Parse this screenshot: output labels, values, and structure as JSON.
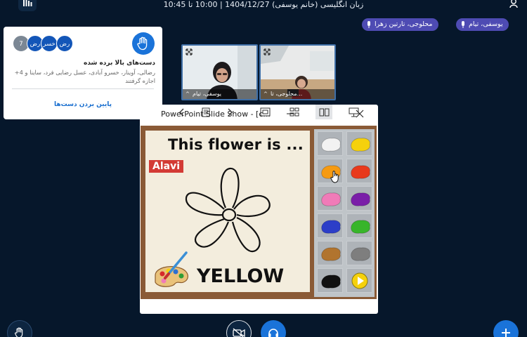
{
  "topbar": {
    "meeting_title": "زبان انگلیسی (خانم یوسفی) 1404/12/27 | 10:00 تا 10:45"
  },
  "talking_indicators": [
    {
      "name": "یوسفی، تیام"
    },
    {
      "name": "محلوجی، تارتین زهرا"
    }
  ],
  "raised_hands": {
    "title": "دست‌های بالا برده شده",
    "names": "رضالی، آوینار، خسرو آبادی، عسل رضایی فرد، ساینا و 4+ اجازه گرفتند",
    "avatars": [
      "رض",
      "خسر",
      "رض",
      "7"
    ],
    "lower_button_label": "پایین بردن دست‌ها"
  },
  "webcams": [
    {
      "name": "یوسفی، تیام"
    },
    {
      "name": "محلوجی، تا..."
    }
  ],
  "presentation": {
    "window_title": "PowerPoint Slide Show - [c...",
    "slide_title": "This flower is ...",
    "name_tag": "Alavi",
    "answer": "YELLOW",
    "palette_colors": [
      "#f2f2f2",
      "#f5d10c",
      "#f59a12",
      "#e8391c",
      "#f07bb8",
      "#7a1ea8",
      "#2c3ec8",
      "#38b52a",
      "#b1742e",
      "#7e7e7e",
      "#111111",
      "#f5d10c"
    ]
  },
  "colors": {
    "background": "#06172b",
    "accent": "#1a73d9",
    "talking_pill": "#4e4bb3"
  },
  "icons": [
    "users-icon",
    "person-icon",
    "microphone-icon",
    "hand-icon",
    "fullscreen-icon",
    "minimize-icon",
    "maximize-icon",
    "close-icon",
    "prev-slide-icon",
    "next-slide-icon",
    "notes-icon",
    "slide-sorter-icon",
    "grid-icon",
    "reading-view-icon",
    "slideshow-icon",
    "camera-off-icon",
    "headset-icon",
    "plus-icon",
    "play-icon"
  ]
}
